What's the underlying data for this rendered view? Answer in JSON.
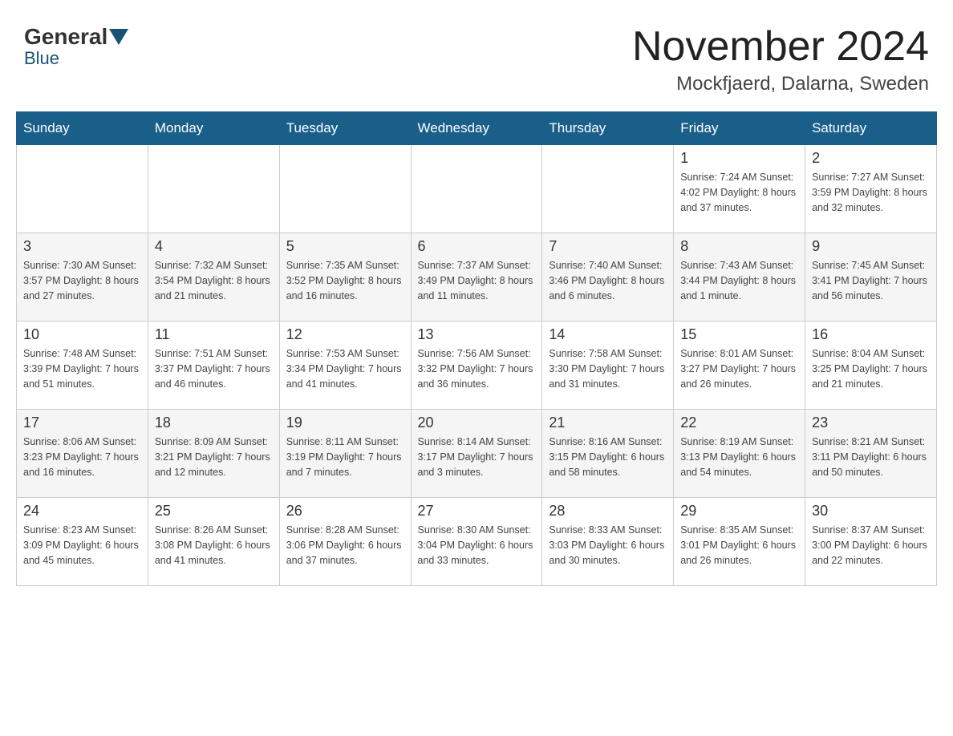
{
  "header": {
    "logo_general": "General",
    "logo_blue": "Blue",
    "month_year": "November 2024",
    "location": "Mockfjaerd, Dalarna, Sweden"
  },
  "days_of_week": [
    "Sunday",
    "Monday",
    "Tuesday",
    "Wednesday",
    "Thursday",
    "Friday",
    "Saturday"
  ],
  "weeks": [
    {
      "days": [
        {
          "num": "",
          "info": ""
        },
        {
          "num": "",
          "info": ""
        },
        {
          "num": "",
          "info": ""
        },
        {
          "num": "",
          "info": ""
        },
        {
          "num": "",
          "info": ""
        },
        {
          "num": "1",
          "info": "Sunrise: 7:24 AM\nSunset: 4:02 PM\nDaylight: 8 hours\nand 37 minutes."
        },
        {
          "num": "2",
          "info": "Sunrise: 7:27 AM\nSunset: 3:59 PM\nDaylight: 8 hours\nand 32 minutes."
        }
      ]
    },
    {
      "days": [
        {
          "num": "3",
          "info": "Sunrise: 7:30 AM\nSunset: 3:57 PM\nDaylight: 8 hours\nand 27 minutes."
        },
        {
          "num": "4",
          "info": "Sunrise: 7:32 AM\nSunset: 3:54 PM\nDaylight: 8 hours\nand 21 minutes."
        },
        {
          "num": "5",
          "info": "Sunrise: 7:35 AM\nSunset: 3:52 PM\nDaylight: 8 hours\nand 16 minutes."
        },
        {
          "num": "6",
          "info": "Sunrise: 7:37 AM\nSunset: 3:49 PM\nDaylight: 8 hours\nand 11 minutes."
        },
        {
          "num": "7",
          "info": "Sunrise: 7:40 AM\nSunset: 3:46 PM\nDaylight: 8 hours\nand 6 minutes."
        },
        {
          "num": "8",
          "info": "Sunrise: 7:43 AM\nSunset: 3:44 PM\nDaylight: 8 hours\nand 1 minute."
        },
        {
          "num": "9",
          "info": "Sunrise: 7:45 AM\nSunset: 3:41 PM\nDaylight: 7 hours\nand 56 minutes."
        }
      ]
    },
    {
      "days": [
        {
          "num": "10",
          "info": "Sunrise: 7:48 AM\nSunset: 3:39 PM\nDaylight: 7 hours\nand 51 minutes."
        },
        {
          "num": "11",
          "info": "Sunrise: 7:51 AM\nSunset: 3:37 PM\nDaylight: 7 hours\nand 46 minutes."
        },
        {
          "num": "12",
          "info": "Sunrise: 7:53 AM\nSunset: 3:34 PM\nDaylight: 7 hours\nand 41 minutes."
        },
        {
          "num": "13",
          "info": "Sunrise: 7:56 AM\nSunset: 3:32 PM\nDaylight: 7 hours\nand 36 minutes."
        },
        {
          "num": "14",
          "info": "Sunrise: 7:58 AM\nSunset: 3:30 PM\nDaylight: 7 hours\nand 31 minutes."
        },
        {
          "num": "15",
          "info": "Sunrise: 8:01 AM\nSunset: 3:27 PM\nDaylight: 7 hours\nand 26 minutes."
        },
        {
          "num": "16",
          "info": "Sunrise: 8:04 AM\nSunset: 3:25 PM\nDaylight: 7 hours\nand 21 minutes."
        }
      ]
    },
    {
      "days": [
        {
          "num": "17",
          "info": "Sunrise: 8:06 AM\nSunset: 3:23 PM\nDaylight: 7 hours\nand 16 minutes."
        },
        {
          "num": "18",
          "info": "Sunrise: 8:09 AM\nSunset: 3:21 PM\nDaylight: 7 hours\nand 12 minutes."
        },
        {
          "num": "19",
          "info": "Sunrise: 8:11 AM\nSunset: 3:19 PM\nDaylight: 7 hours\nand 7 minutes."
        },
        {
          "num": "20",
          "info": "Sunrise: 8:14 AM\nSunset: 3:17 PM\nDaylight: 7 hours\nand 3 minutes."
        },
        {
          "num": "21",
          "info": "Sunrise: 8:16 AM\nSunset: 3:15 PM\nDaylight: 6 hours\nand 58 minutes."
        },
        {
          "num": "22",
          "info": "Sunrise: 8:19 AM\nSunset: 3:13 PM\nDaylight: 6 hours\nand 54 minutes."
        },
        {
          "num": "23",
          "info": "Sunrise: 8:21 AM\nSunset: 3:11 PM\nDaylight: 6 hours\nand 50 minutes."
        }
      ]
    },
    {
      "days": [
        {
          "num": "24",
          "info": "Sunrise: 8:23 AM\nSunset: 3:09 PM\nDaylight: 6 hours\nand 45 minutes."
        },
        {
          "num": "25",
          "info": "Sunrise: 8:26 AM\nSunset: 3:08 PM\nDaylight: 6 hours\nand 41 minutes."
        },
        {
          "num": "26",
          "info": "Sunrise: 8:28 AM\nSunset: 3:06 PM\nDaylight: 6 hours\nand 37 minutes."
        },
        {
          "num": "27",
          "info": "Sunrise: 8:30 AM\nSunset: 3:04 PM\nDaylight: 6 hours\nand 33 minutes."
        },
        {
          "num": "28",
          "info": "Sunrise: 8:33 AM\nSunset: 3:03 PM\nDaylight: 6 hours\nand 30 minutes."
        },
        {
          "num": "29",
          "info": "Sunrise: 8:35 AM\nSunset: 3:01 PM\nDaylight: 6 hours\nand 26 minutes."
        },
        {
          "num": "30",
          "info": "Sunrise: 8:37 AM\nSunset: 3:00 PM\nDaylight: 6 hours\nand 22 minutes."
        }
      ]
    }
  ]
}
